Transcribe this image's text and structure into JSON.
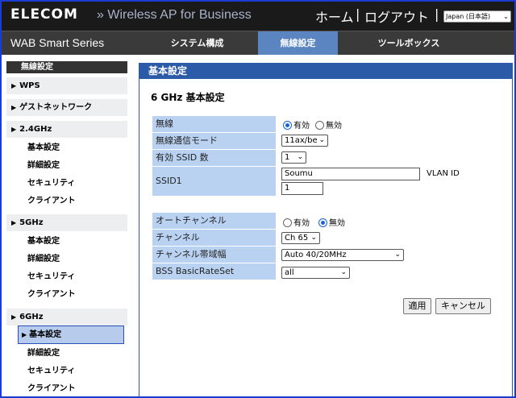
{
  "header": {
    "logo": "ELECOM",
    "product": "» Wireless AP for Business",
    "home": "ホーム",
    "separator": "|",
    "logout": "ログアウト",
    "language": "Japan (日本語)"
  },
  "nav": {
    "series": "WAB Smart Series",
    "tabs": [
      {
        "label": "システム構成"
      },
      {
        "label": "無線設定"
      },
      {
        "label": "ツールボックス"
      }
    ],
    "active_tab": "無線設定"
  },
  "sidebar": {
    "title": "無線設定",
    "sections": [
      {
        "label": "WPS",
        "items": []
      },
      {
        "label": "ゲストネットワーク",
        "items": []
      },
      {
        "label": "2.4GHz",
        "items": [
          "基本設定",
          "詳細設定",
          "セキュリティ",
          "クライアント"
        ]
      },
      {
        "label": "5GHz",
        "items": [
          "基本設定",
          "詳細設定",
          "セキュリティ",
          "クライアント"
        ]
      },
      {
        "label": "6GHz",
        "items": [
          "基本設定",
          "詳細設定",
          "セキュリティ",
          "クライアント"
        ]
      }
    ],
    "active_item": "6GHz/基本設定"
  },
  "main": {
    "header": "基本設定",
    "section_title": "6 GHz 基本設定",
    "rows": {
      "wireless": {
        "label": "無線",
        "options": [
          "有効",
          "無効"
        ],
        "selected": "有効"
      },
      "mode": {
        "label": "無線通信モード",
        "value": "11ax/be"
      },
      "ssid_count": {
        "label": "有効 SSID 数",
        "value": "1"
      },
      "ssid1": {
        "label": "SSID1",
        "value": "Soumu",
        "vlan_label": "VLAN ID",
        "vlan_value": "1"
      },
      "auto_channel": {
        "label": "オートチャンネル",
        "options": [
          "有効",
          "無効"
        ],
        "selected": "無効"
      },
      "channel": {
        "label": "チャンネル",
        "value": "Ch 65"
      },
      "bandwidth": {
        "label": "チャンネル帯域幅",
        "value": "Auto 40/20MHz"
      },
      "basic_rate": {
        "label": "BSS BasicRateSet",
        "value": "all"
      }
    },
    "buttons": {
      "apply": "適用",
      "cancel": "キャンセル"
    }
  },
  "colors": {
    "border": "#1c3bd1",
    "topbar": "#1a1a1a",
    "navbar": "#3a3a3a",
    "active_tab": "#5a85c0",
    "section_header": "#2b5aa8",
    "label_bg": "#bad2f2",
    "active_side_item": "#b7cbed"
  }
}
